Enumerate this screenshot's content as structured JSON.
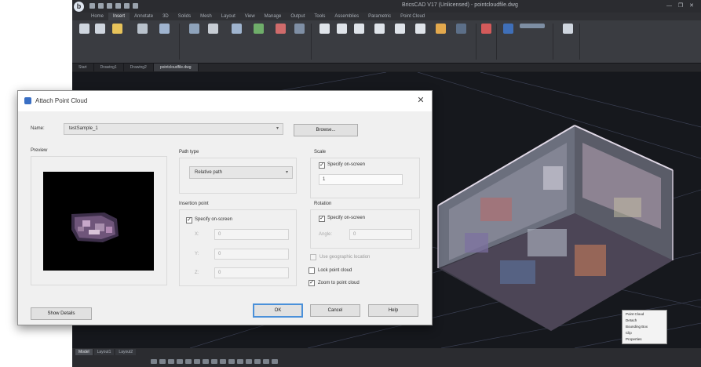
{
  "app": {
    "title": "BricsCAD V17 (Unlicensed) - pointcloudfile.dwg",
    "ribbon_tabs": [
      "Home",
      "Insert",
      "Annotate",
      "3D",
      "Solids",
      "Mesh",
      "Layout",
      "View",
      "Manage",
      "Output",
      "Tools",
      "Assemblies",
      "Parametric",
      "Point Cloud"
    ],
    "active_ribbon_tab": "Insert",
    "doc_tabs": [
      "Start",
      "Drawing1",
      "Drawing2",
      "pointcloudfile.dwg"
    ],
    "active_doc_tab": "pointcloudfile.dwg",
    "layout_tabs": [
      "Model",
      "Layout1",
      "Layout2"
    ],
    "active_layout_tab": "Model"
  },
  "context_menu": {
    "items": [
      "Point Cloud",
      "Detach",
      "Bounding Box",
      "Clip",
      "Properties"
    ]
  },
  "dialog": {
    "title": "Attach Point Cloud",
    "name_label": "Name:",
    "name_value": "testSample_1",
    "browse_label": "Browse...",
    "preview_label": "Preview",
    "path_type_label": "Path type",
    "path_type_value": "Relative path",
    "insertion_point_label": "Insertion point",
    "insertion_specify_label": "Specify on-screen",
    "insertion_specify_checked": true,
    "coord_x_label": "X:",
    "coord_y_label": "Y:",
    "coord_z_label": "Z:",
    "coord_x": "0",
    "coord_y": "0",
    "coord_z": "0",
    "scale_label": "Scale",
    "scale_specify_label": "Specify on-screen",
    "scale_specify_checked": true,
    "scale_value": "1",
    "rotation_label": "Rotation",
    "rotation_specify_label": "Specify on-screen",
    "rotation_specify_checked": true,
    "angle_label": "Angle:",
    "angle_value": "0",
    "geo_label": "Use geographic location",
    "geo_checked": false,
    "lock_label": "Lock point cloud",
    "lock_checked": false,
    "zoom_label": "Zoom to point cloud",
    "zoom_checked": true,
    "show_details_label": "Show Details",
    "ok_label": "OK",
    "cancel_label": "Cancel",
    "help_label": "Help"
  },
  "colors": {
    "viewport_bg": "#16181d",
    "dialog_bg": "#f0f0f0",
    "accent": "#4a90d9"
  }
}
